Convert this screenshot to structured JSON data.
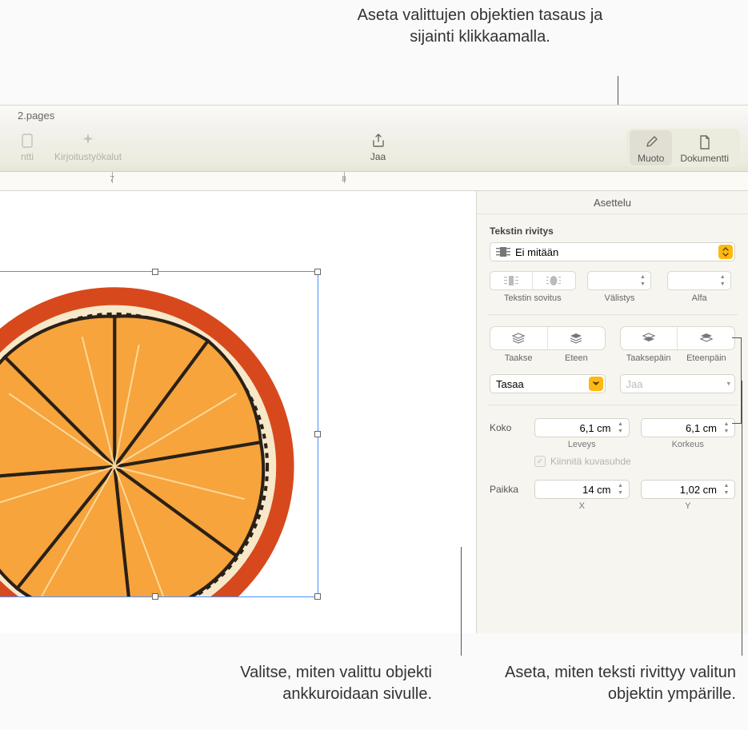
{
  "window": {
    "title": "2.pages"
  },
  "toolbar": {
    "doc_btn": "ntti",
    "writing_tools": "Kirjoitustyökalut",
    "share": "Jaa",
    "format": "Muoto",
    "document": "Dokumentti"
  },
  "ruler": {
    "ticks": [
      "7",
      "8"
    ]
  },
  "sidebar": {
    "tab": "Asettelu",
    "wrap_title": "Tekstin rivitys",
    "wrap_value": "Ei mitään",
    "fit_label": "Tekstin sovitus",
    "spacing_label": "Välistys",
    "alpha_label": "Alfa",
    "order_back": "Taakse",
    "order_front": "Eteen",
    "order_backward": "Taaksepäin",
    "order_forward": "Eteenpäin",
    "align_label": "Tasaa",
    "distribute_label": "Jaa",
    "size_label": "Koko",
    "width_value": "6,1 cm",
    "width_label": "Leveys",
    "height_value": "6,1 cm",
    "height_label": "Korkeus",
    "lock_aspect": "Kiinnitä kuvasuhde",
    "pos_label": "Paikka",
    "x_value": "14 cm",
    "x_label": "X",
    "y_value": "1,02 cm",
    "y_label": "Y"
  },
  "callouts": {
    "top": "Aseta valittujen objektien tasaus ja sijainti klikkaamalla.",
    "bottom_left": "Valitse, miten valittu objekti ankkuroidaan sivulle.",
    "bottom_right": "Aseta, miten teksti rivittyy valitun objektin ympärille."
  }
}
